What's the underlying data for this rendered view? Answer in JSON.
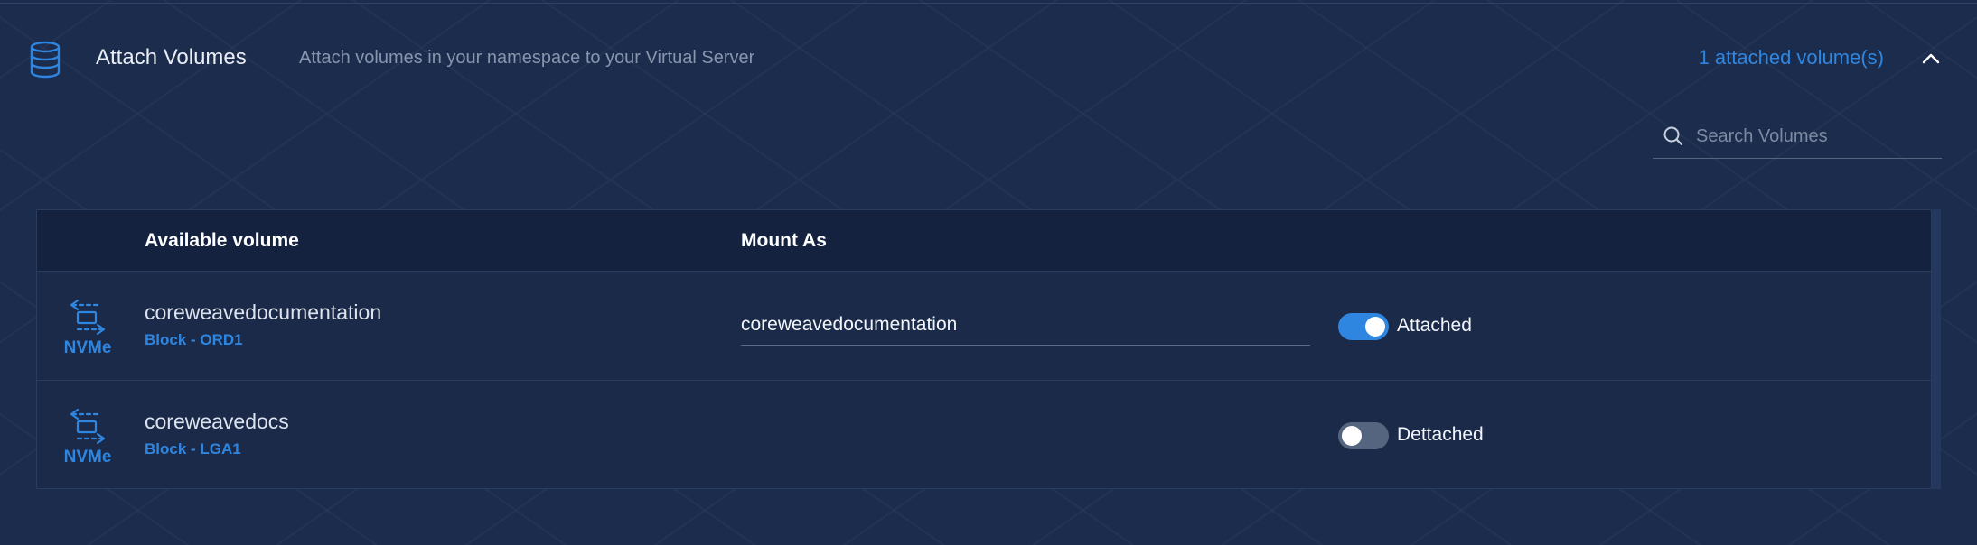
{
  "header": {
    "title": "Attach Volumes",
    "subtitle": "Attach volumes in your namespace to your Virtual Server",
    "attached_count": "1 attached volume(s)",
    "icon": "database-icon",
    "collapse_icon": "chevron-up-icon"
  },
  "search": {
    "placeholder": "Search Volumes",
    "value": ""
  },
  "table": {
    "columns": [
      "Available volume",
      "Mount As"
    ],
    "rows": [
      {
        "type_icon": "nvme-icon",
        "type_label": "NVMe",
        "name": "coreweavedocumentation",
        "meta": "Block - ORD1",
        "mount_as": "coreweavedocumentation",
        "attached": true,
        "status": "Attached"
      },
      {
        "type_icon": "nvme-icon",
        "type_label": "NVMe",
        "name": "coreweavedocs",
        "meta": "Block - LGA1",
        "mount_as": "",
        "attached": false,
        "status": "Dettached"
      }
    ]
  },
  "colors": {
    "background": "#1c2c4c",
    "accent": "#2f86e0",
    "table_header": "#14223f",
    "toggle_off": "#56657f"
  }
}
